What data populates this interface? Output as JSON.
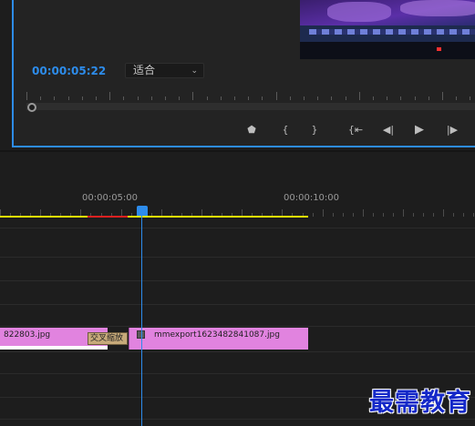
{
  "monitor": {
    "timecode": "00:00:05:22",
    "fit_select": {
      "value": "适合"
    },
    "controls": [
      {
        "name": "add-marker-icon",
        "glyph": "⬟"
      },
      {
        "name": "mark-in-icon",
        "glyph": "{"
      },
      {
        "name": "mark-out-icon",
        "glyph": "}"
      },
      {
        "name": "go-to-in-icon",
        "glyph": "{⇤"
      },
      {
        "name": "step-back-icon",
        "glyph": "◀|"
      },
      {
        "name": "play-icon",
        "glyph": "▶"
      },
      {
        "name": "step-forward-icon",
        "glyph": "|▶"
      }
    ]
  },
  "timeline": {
    "time_labels": [
      "00:00:05:00",
      "00:00:10:00"
    ],
    "clips": {
      "left_name": "822803.jpg",
      "right_name": "mmexport1623482841087.jpg",
      "transition_label": "交叉缩放"
    },
    "colors": {
      "playhead": "#2d8ceb",
      "clip": "#e183df",
      "work_area": "#e8e800",
      "render_bar": "#e02020"
    }
  },
  "watermark": {
    "text": "最需教育"
  }
}
